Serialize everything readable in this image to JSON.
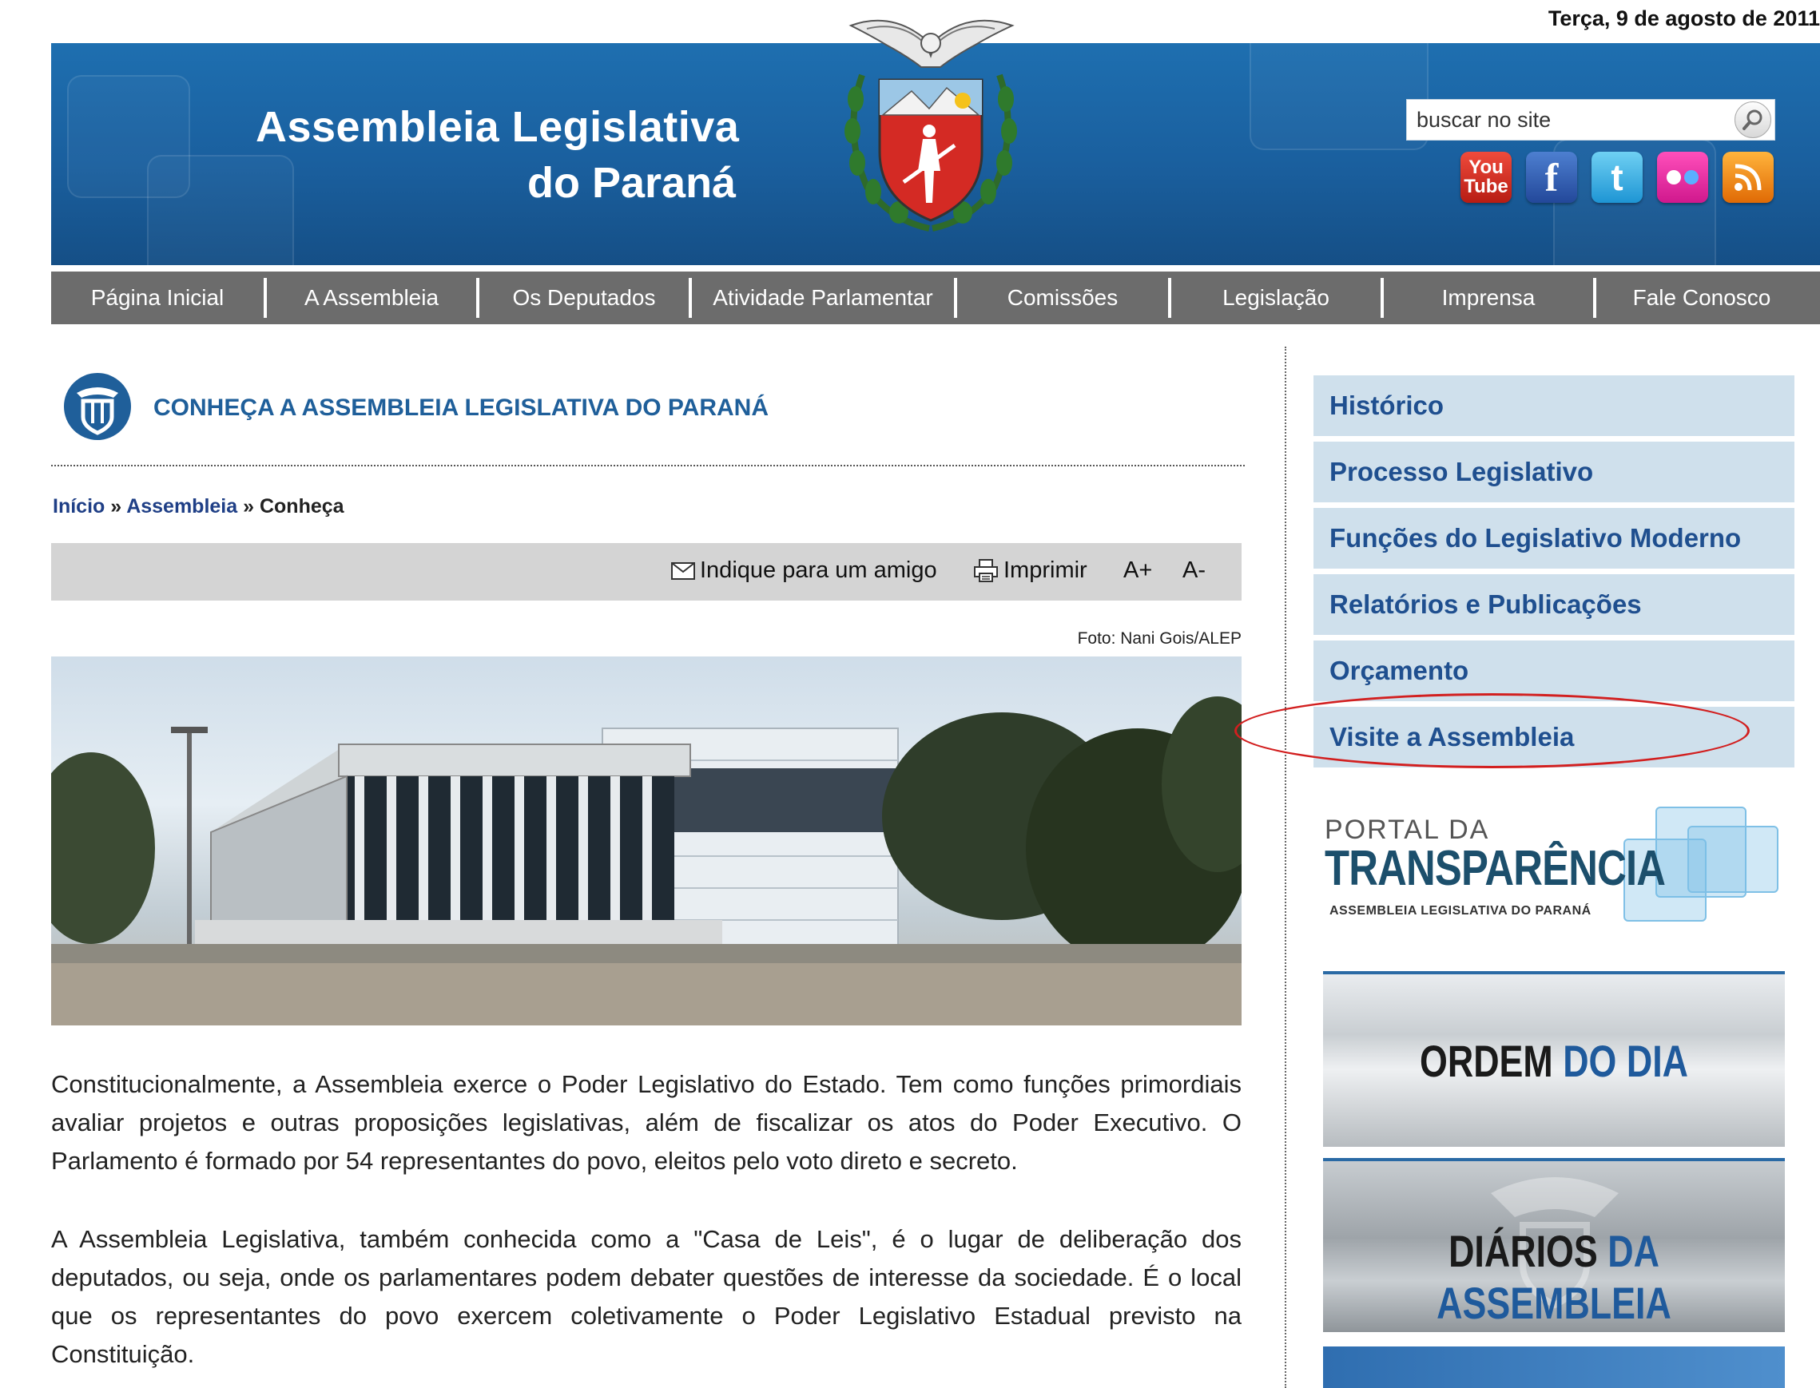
{
  "date": "Terça, 9 de agosto de 2011",
  "header": {
    "title_line1": "Assembleia Legislativa",
    "title_line2": "do Paraná"
  },
  "search": {
    "value": "buscar no site"
  },
  "social": {
    "youtube_line1": "You",
    "youtube_line2": "Tube",
    "facebook": "f",
    "twitter": "t"
  },
  "nav": {
    "items": [
      "Página Inicial",
      "A Assembleia",
      "Os Deputados",
      "Atividade Parlamentar",
      "Comissões",
      "Legislação",
      "Imprensa",
      "Fale Conosco"
    ]
  },
  "page": {
    "title": "CONHEÇA A ASSEMBLEIA LEGISLATIVA DO PARANÁ",
    "breadcrumb": {
      "home": "Início",
      "sep": "»",
      "section": "Assembleia",
      "current": "Conheça"
    },
    "tools": {
      "email": "Indique para um amigo",
      "print": "Imprimir",
      "font_up": "A+",
      "font_down": "A-"
    },
    "photo_credit": "Foto: Nani Gois/ALEP",
    "paragraphs": [
      "Constitucionalmente, a Assembleia exerce o Poder Legislativo do Estado. Tem como funções primordiais avaliar projetos e outras proposições legislativas, além de fiscalizar os atos do Poder Executivo. O Parlamento é formado por 54 representantes do povo, eleitos pelo voto direto e secreto.",
      "A Assembleia Legislativa, também conhecida como a \"Casa de Leis\", é o lugar de deliberação dos deputados, ou seja, onde os parlamentares podem debater questões de interesse da sociedade. É o local que os representantes do povo exercem coletivamente o Poder Legislativo Estadual previsto na Constituição."
    ]
  },
  "sidebar": {
    "items": [
      "Histórico",
      "Processo Legislativo",
      "Funções do Legislativo Moderno",
      "Relatórios e Publicações",
      "Orçamento",
      "Visite a Assembleia"
    ],
    "portal": {
      "line1": "PORTAL DA",
      "line2": "TRANSPARÊNCIA",
      "line3": "ASSEMBLEIA LEGISLATIVA DO PARANÁ"
    },
    "banners": {
      "ordem_dark": "ORDEM",
      "ordem_blue": "DO DIA",
      "diarios_dark": "DIÁRIOS",
      "diarios_blue": "DA ASSEMBLEIA"
    }
  },
  "colors": {
    "brand_blue": "#1a5f9e",
    "nav_gray": "#6c6c6c",
    "link_blue": "#1f4f8f",
    "highlight_red": "#d21f1f"
  }
}
